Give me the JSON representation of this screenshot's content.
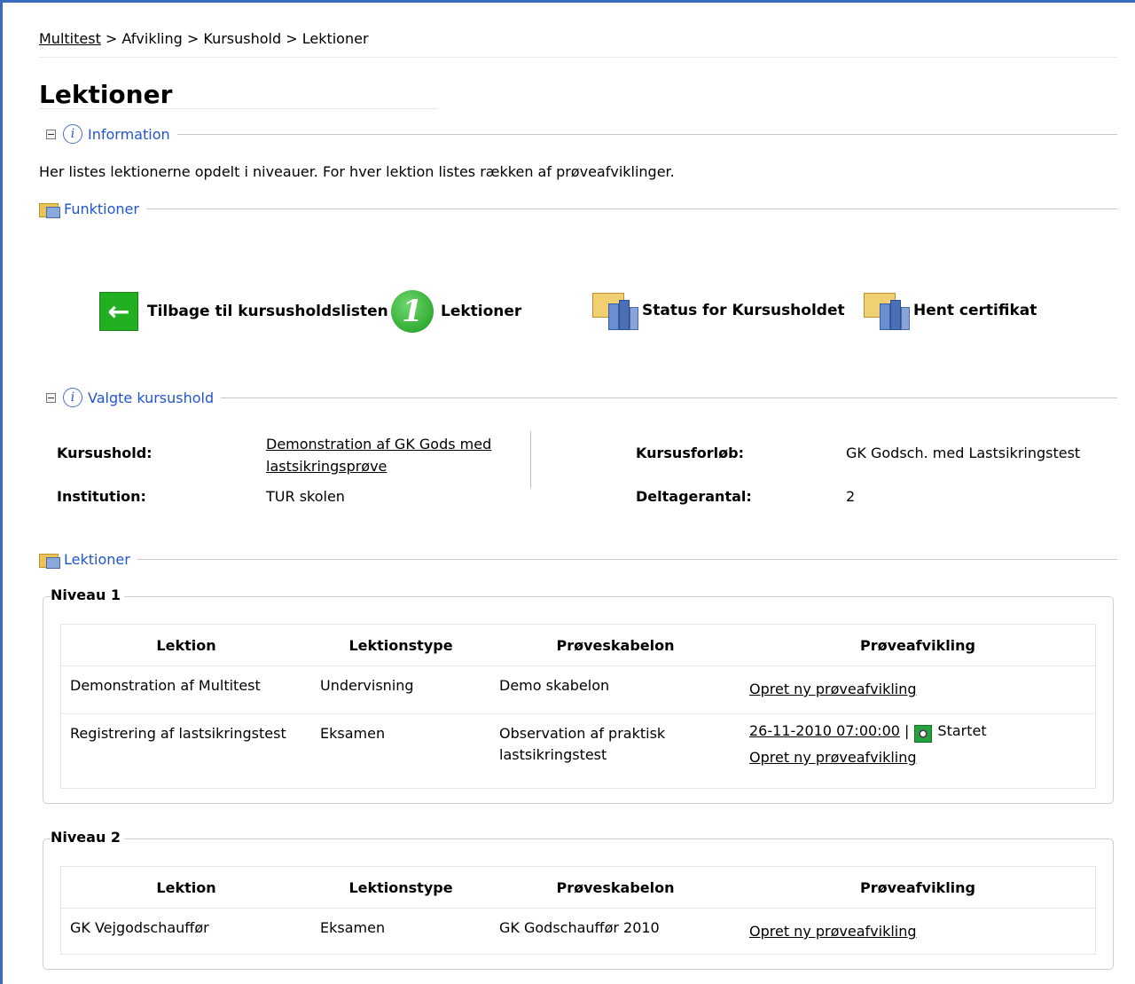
{
  "breadcrumb": {
    "root": "Multitest",
    "sep": " > ",
    "items": [
      "Afvikling",
      "Kursushold",
      "Lektioner"
    ]
  },
  "page_title": "Lektioner",
  "sections": {
    "information": "Information",
    "funktioner": "Funktioner",
    "valgte": "Valgte kursushold",
    "lektioner": "Lektioner"
  },
  "intro_text": "Her listes lektionerne opdelt i niveauer. For hver lektion listes rækken af prøveafviklinger.",
  "functions": {
    "back": "Tilbage til kursusholdslisten",
    "lektioner": "Lektioner",
    "status": "Status for Kursusholdet",
    "certifikat": "Hent certifikat"
  },
  "kursushold_info": {
    "kursushold_label": "Kursushold:",
    "kursushold_value_line1": "Demonstration af GK Gods med",
    "kursushold_value_line2": "lastsikringsprøve",
    "institution_label": "Institution:",
    "institution_value": "TUR skolen",
    "kursusforloeb_label": "Kursusforløb:",
    "kursusforloeb_value": "GK Godsch. med Lastsikringstest",
    "deltagerantal_label": "Deltagerantal:",
    "deltagerantal_value": "2"
  },
  "table_headers": {
    "lektion": "Lektion",
    "type": "Lektionstype",
    "skabelon": "Prøveskabelon",
    "afvikling": "Prøveafvikling"
  },
  "niveau1": {
    "title": "Niveau 1",
    "rows": [
      {
        "lektion": "Demonstration af Multitest",
        "type": "Undervisning",
        "skabelon1": "Demo skabelon",
        "skabelon2": "",
        "create_link": "Opret ny prøveafvikling"
      },
      {
        "lektion": "Registrering af lastsikringstest",
        "type": "Eksamen",
        "skabelon1": "Observation af praktisk",
        "skabelon2": "lastsikringstest",
        "date_link": "26-11-2010 07:00:00",
        "pipe": "|",
        "status": "Startet",
        "create_link": "Opret ny prøveafvikling"
      }
    ]
  },
  "niveau2": {
    "title": "Niveau 2",
    "rows": [
      {
        "lektion": "GK Vejgodschauffør",
        "type": "Eksamen",
        "skabelon1": "GK Godschauffør 2010",
        "create_link": "Opret ny prøveafvikling"
      }
    ]
  }
}
